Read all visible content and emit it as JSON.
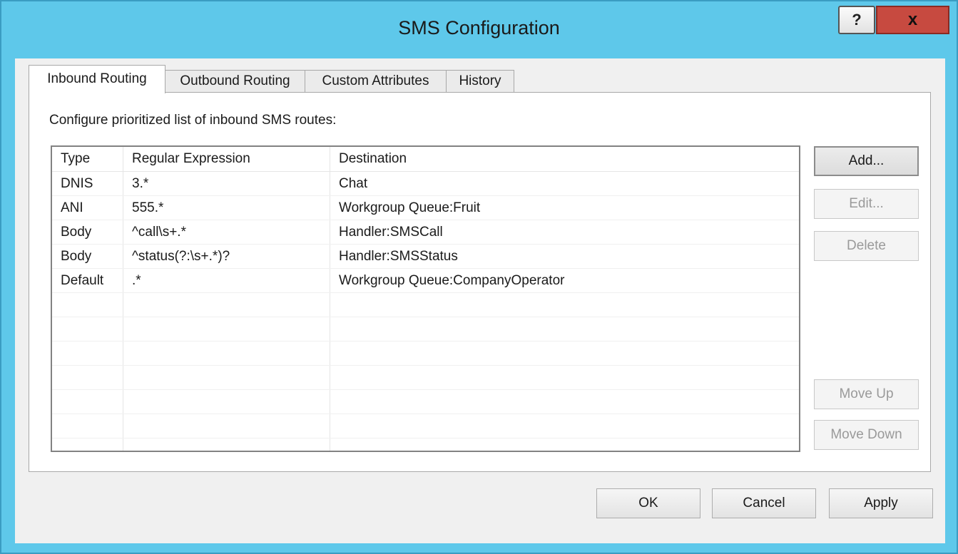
{
  "window": {
    "title": "SMS Configuration",
    "help_label": "?",
    "close_label": "x"
  },
  "tabs": [
    {
      "label": "Inbound Routing",
      "active": true
    },
    {
      "label": "Outbound Routing",
      "active": false
    },
    {
      "label": "Custom Attributes",
      "active": false
    },
    {
      "label": "History",
      "active": false
    }
  ],
  "panel": {
    "instruction": "Configure prioritized list of inbound SMS routes:"
  },
  "routes": {
    "columns": [
      "Type",
      "Regular Expression",
      "Destination"
    ],
    "rows": [
      [
        "DNIS",
        "3.*",
        "Chat"
      ],
      [
        "ANI",
        "555.*",
        "Workgroup Queue:Fruit"
      ],
      [
        "Body",
        "^call\\s+.*",
        "Handler:SMSCall"
      ],
      [
        "Body",
        "^status(?:\\s+.*)?",
        "Handler:SMSStatus"
      ],
      [
        "Default",
        ".*",
        "Workgroup Queue:CompanyOperator"
      ]
    ]
  },
  "side_buttons": {
    "add": "Add...",
    "edit": "Edit...",
    "delete": "Delete",
    "move_up": "Move Up",
    "move_down": "Move Down"
  },
  "dialog_buttons": {
    "ok": "OK",
    "cancel": "Cancel",
    "apply": "Apply"
  },
  "colors": {
    "title_bar": "#5ec8ea",
    "close_button": "#c74a40",
    "dialog_background": "#f0f0f0"
  }
}
